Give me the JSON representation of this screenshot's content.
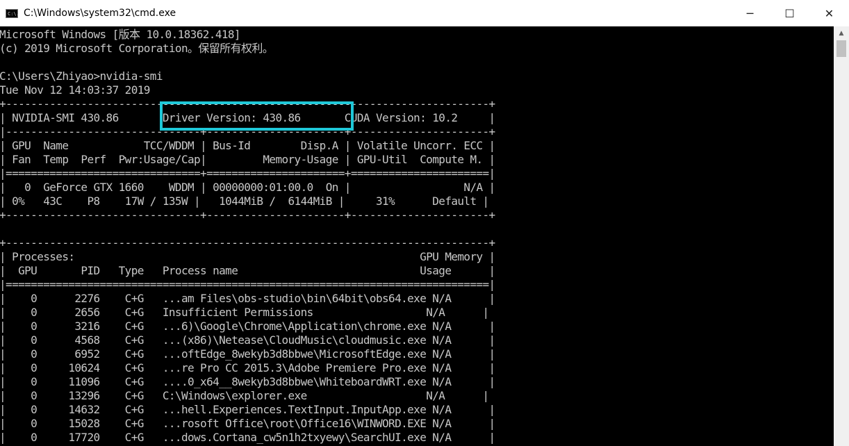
{
  "window": {
    "title": "C:\\Windows\\system32\\cmd.exe",
    "app_icon_text": "C:\\.",
    "minimize_glyph": "─",
    "maximize_glyph": "☐",
    "close_glyph": "✕"
  },
  "scrollbar": {
    "up_glyph": "▲"
  },
  "console": {
    "lines": [
      "Microsoft Windows [版本 10.0.18362.418]",
      "(c) 2019 Microsoft Corporation。保留所有权利。",
      "",
      "C:\\Users\\Zhiyao>nvidia-smi",
      "Tue Nov 12 14:03:37 2019",
      "+-----------------------------------------------------------------------------+",
      "| NVIDIA-SMI 430.86       Driver Version: 430.86       CUDA Version: 10.2     |",
      "|-------------------------------+----------------------+----------------------+",
      "| GPU  Name            TCC/WDDM | Bus-Id        Disp.A | Volatile Uncorr. ECC |",
      "| Fan  Temp  Perf  Pwr:Usage/Cap|         Memory-Usage | GPU-Util  Compute M. |",
      "|===============================+======================+======================|",
      "|   0  GeForce GTX 1660    WDDM | 00000000:01:00.0  On |                  N/A |",
      "| 0%   43C    P8    17W / 135W |   1044MiB /  6144MiB |     31%      Default |",
      "+-------------------------------+----------------------+----------------------+",
      "",
      "+-----------------------------------------------------------------------------+",
      "| Processes:                                                       GPU Memory |",
      "|  GPU       PID   Type   Process name                             Usage      |",
      "|=============================================================================|",
      "|    0      2276    C+G   ...am Files\\obs-studio\\bin\\64bit\\obs64.exe N/A      |",
      "|    0      2656    C+G   Insufficient Permissions                  N/A      |",
      "|    0      3216    C+G   ...6)\\Google\\Chrome\\Application\\chrome.exe N/A      |",
      "|    0      4568    C+G   ...(x86)\\Netease\\CloudMusic\\cloudmusic.exe N/A      |",
      "|    0      6952    C+G   ...oftEdge_8wekyb3d8bbwe\\MicrosoftEdge.exe N/A      |",
      "|    0     10624    C+G   ...re Pro CC 2015.3\\Adobe Premiere Pro.exe N/A      |",
      "|    0     11096    C+G   ....0_x64__8wekyb3d8bbwe\\WhiteboardWRT.exe N/A      |",
      "|    0     13296    C+G   C:\\Windows\\explorer.exe                   N/A      |",
      "|    0     14632    C+G   ...hell.Experiences.TextInput.InputApp.exe N/A      |",
      "|    0     15028    C+G   ...rosoft Office\\root\\Office16\\WINWORD.EXE N/A      |",
      "|    0     17720    C+G   ...dows.Cortana_cw5n1h2txyewy\\SearchUI.exe N/A      |"
    ]
  },
  "accent": {
    "highlight_color": "#1fc8d8"
  }
}
